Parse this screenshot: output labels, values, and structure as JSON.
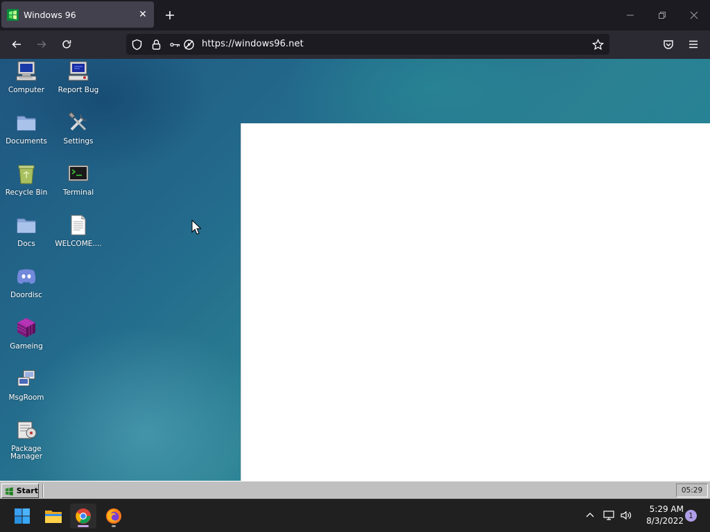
{
  "browser": {
    "tab": {
      "title": "Windows 96",
      "favicon": "windows96-logo-icon"
    },
    "url": "https://windows96.net",
    "colors": {
      "chrome_dark": "#1c1b22",
      "toolbar": "#2b2a33",
      "tab_active": "#42414d"
    }
  },
  "desktop": {
    "icons": [
      {
        "label": "Computer",
        "icon": "computer-icon"
      },
      {
        "label": "Report Bug",
        "icon": "report-bug-icon"
      },
      {
        "label": "Documents",
        "icon": "folder-icon"
      },
      {
        "label": "Settings",
        "icon": "settings-tools-icon"
      },
      {
        "label": "Recycle Bin",
        "icon": "recycle-bin-icon"
      },
      {
        "label": "Terminal",
        "icon": "terminal-icon"
      },
      {
        "label": "Docs",
        "icon": "folder-icon"
      },
      {
        "label": "WELCOME....",
        "icon": "text-document-icon"
      },
      {
        "label": "Doordisc",
        "icon": "doordisc-icon"
      },
      {
        "label": "Gameing",
        "icon": "purple-cube-icon"
      },
      {
        "label": "MsgRoom",
        "icon": "msgroom-icon"
      },
      {
        "label": "Package\nManager",
        "icon": "package-manager-icon"
      }
    ],
    "taskbar": {
      "start_label": "Start",
      "clock": "05:29"
    }
  },
  "os_taskbar": {
    "apps": [
      "windows-start-icon",
      "file-explorer-icon",
      "chrome-icon",
      "firefox-icon"
    ],
    "time": "5:29 AM",
    "date": "8/3/2022",
    "notification_count": "1"
  }
}
